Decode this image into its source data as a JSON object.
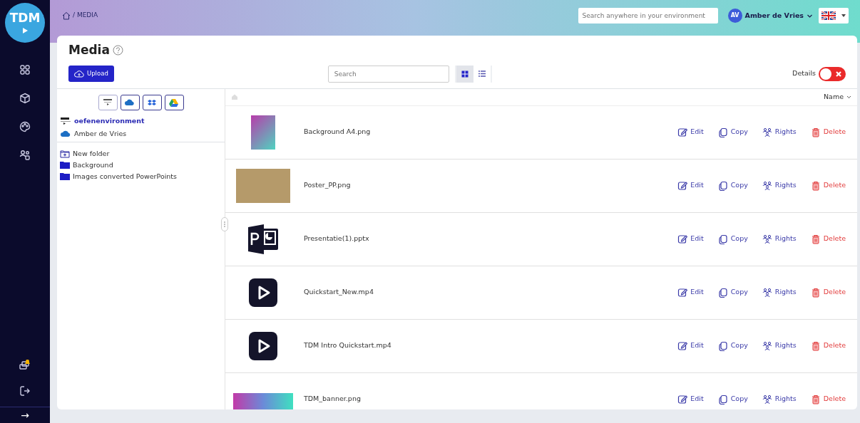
{
  "sidebar": {
    "logo_text": "TDM",
    "bottom_arrow": "→"
  },
  "topbar": {
    "breadcrumb": "/ MEDIA",
    "search": {
      "placeholder": "Search anywhere in your environment"
    },
    "user": {
      "initials": "AV",
      "name": "Amber de Vries"
    }
  },
  "page": {
    "title": "Media",
    "upload": "Upload",
    "search": {
      "placeholder": "Search"
    },
    "view_modes": [
      {
        "kind": "grid",
        "selected": true
      },
      {
        "kind": "list",
        "selected": false
      }
    ],
    "details": {
      "label": "Details",
      "on": false
    }
  },
  "storage_sources": [
    {
      "kind": "tdm"
    },
    {
      "kind": "onedrive"
    },
    {
      "kind": "dropbox"
    },
    {
      "kind": "drive"
    }
  ],
  "accounts": [
    {
      "kind": "tdm",
      "label": "oefenenvironment"
    },
    {
      "kind": "cloud",
      "label": "Amber de Vries"
    }
  ],
  "folders": [
    {
      "kind": "new",
      "label": "New folder"
    },
    {
      "kind": "folder",
      "label": "Background"
    },
    {
      "kind": "folder",
      "label": "Images converted PowerPoints"
    }
  ],
  "list": {
    "sort_label": "Name",
    "files": [
      {
        "name": "Background A4.png",
        "kind": "gradient",
        "actions": [
          {
            "kind": "edit",
            "label": "Edit"
          },
          {
            "kind": "copy",
            "label": "Copy"
          },
          {
            "kind": "rights",
            "label": "Rights"
          },
          {
            "kind": "delete",
            "label": "Delete"
          }
        ]
      },
      {
        "name": "Poster_PP.png",
        "kind": "photo",
        "actions": [
          {
            "kind": "edit",
            "label": "Edit"
          },
          {
            "kind": "copy",
            "label": "Copy"
          },
          {
            "kind": "rights",
            "label": "Rights"
          },
          {
            "kind": "delete",
            "label": "Delete"
          }
        ]
      },
      {
        "name": "Presentatie(1).pptx",
        "kind": "pptx",
        "actions": [
          {
            "kind": "edit",
            "label": "Edit"
          },
          {
            "kind": "copy",
            "label": "Copy"
          },
          {
            "kind": "rights",
            "label": "Rights"
          },
          {
            "kind": "delete",
            "label": "Delete"
          }
        ]
      },
      {
        "name": "Quickstart_New.mp4",
        "kind": "video",
        "actions": [
          {
            "kind": "edit",
            "label": "Edit"
          },
          {
            "kind": "copy",
            "label": "Copy"
          },
          {
            "kind": "rights",
            "label": "Rights"
          },
          {
            "kind": "delete",
            "label": "Delete"
          }
        ]
      },
      {
        "name": "TDM Intro Quickstart.mp4",
        "kind": "video",
        "actions": [
          {
            "kind": "edit",
            "label": "Edit"
          },
          {
            "kind": "copy",
            "label": "Copy"
          },
          {
            "kind": "rights",
            "label": "Rights"
          },
          {
            "kind": "delete",
            "label": "Delete"
          }
        ]
      },
      {
        "name": "TDM_banner.png",
        "kind": "banner",
        "actions": [
          {
            "kind": "edit",
            "label": "Edit"
          },
          {
            "kind": "copy",
            "label": "Copy"
          },
          {
            "kind": "rights",
            "label": "Rights"
          },
          {
            "kind": "delete",
            "label": "Delete"
          }
        ]
      }
    ]
  }
}
